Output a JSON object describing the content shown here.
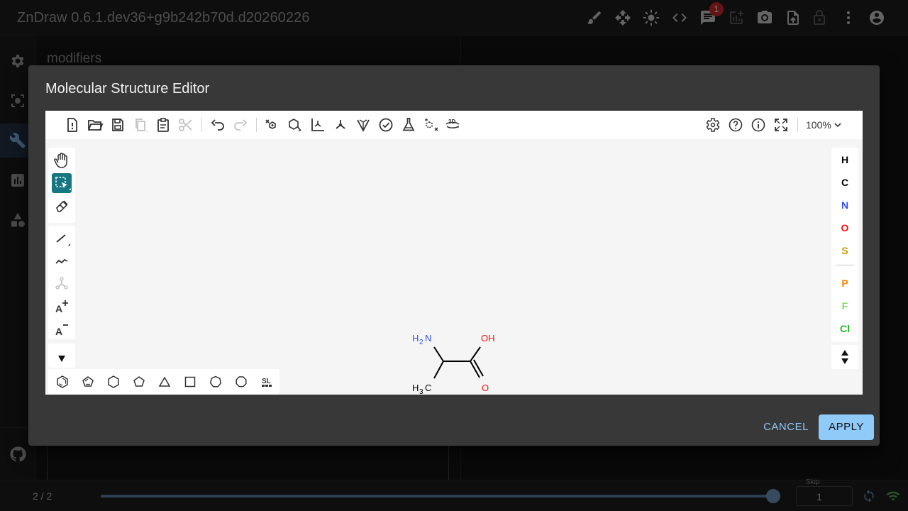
{
  "app": {
    "title": "ZnDraw 0.6.1.dev36+g9b242b70d.d20260226",
    "chat_badge_count": "1",
    "toolbar_icons": [
      "brush-icon",
      "move-icon",
      "brightness-icon",
      "code-icon",
      "chat-icon",
      "add-chart-icon",
      "camera-icon",
      "upload-icon",
      "lock-icon",
      "more-vert-icon",
      "account-icon"
    ]
  },
  "sidebar": {
    "items": [
      "settings-icon",
      "selection-icon",
      "modifiers-icon",
      "analysis-icon",
      "geometry-icon"
    ],
    "active": "modifiers-icon",
    "footer_icon": "github-icon"
  },
  "panel": {
    "title": "modifiers"
  },
  "bottom": {
    "frame_label": "2 / 2",
    "progress": 1.0,
    "skip_label": "Skip",
    "skip_value": "1"
  },
  "dialog": {
    "title": "Molecular Structure Editor",
    "cancel_label": "CANCEL",
    "apply_label": "APPLY"
  },
  "editor": {
    "zoom": "100%",
    "toolbar_left": [
      "new-file-icon",
      "open-icon",
      "save-icon",
      "copy-icon",
      "paste-icon",
      "cut-icon",
      "undo-icon",
      "redo-icon",
      "layout-icon",
      "clean-icon",
      "arom-icon",
      "dearom-icon",
      "stereo-icon",
      "check-icon",
      "analyse-icon",
      "explicit-h-icon",
      "3d-view-icon"
    ],
    "toolbar_right": [
      "settings-icon",
      "help-icon",
      "about-icon",
      "fullscreen-icon"
    ],
    "tools": [
      "hand-icon",
      "select-icon",
      "eraser-icon",
      "bond-icon",
      "chain-icon",
      "sgroup-icon",
      "charge-plus-icon",
      "charge-minus-icon"
    ],
    "active_tool": "select-icon",
    "atoms": [
      {
        "symbol": "H",
        "color": "#000000"
      },
      {
        "symbol": "C",
        "color": "#000000"
      },
      {
        "symbol": "N",
        "color": "#304ff7"
      },
      {
        "symbol": "O",
        "color": "#ff0d0d"
      },
      {
        "symbol": "S",
        "color": "#c99a00"
      },
      {
        "symbol": "P",
        "color": "#ff8000"
      },
      {
        "symbol": "F",
        "color": "#78e050"
      },
      {
        "symbol": "Cl",
        "color": "#1fc01f"
      }
    ],
    "templates": [
      "benzene-icon",
      "cyclopentadiene-icon",
      "cyclohexane-icon",
      "cyclopentane-icon",
      "cyclopropane-icon",
      "cyclobutane-icon",
      "cycloheptane-icon",
      "cyclooctane-icon",
      "sl-icon"
    ],
    "molecule_labels": {
      "amine_h": "H",
      "amine_sub": "2",
      "amine_n": "N",
      "oh": "OH",
      "methyl_h": "H",
      "methyl_sub": "3",
      "methyl_c": "C",
      "carbonyl_o": "O"
    }
  }
}
